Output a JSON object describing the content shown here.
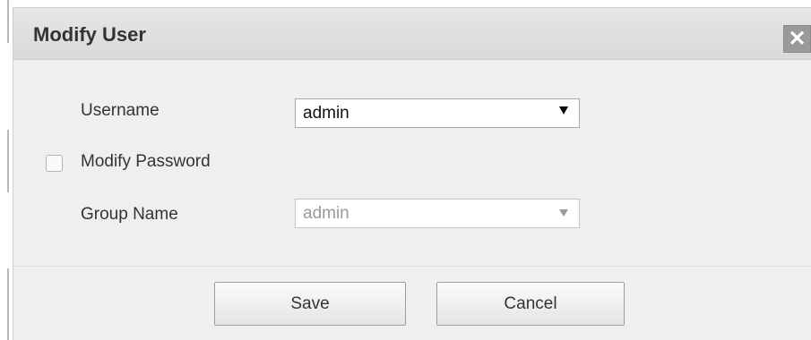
{
  "dialog": {
    "title": "Modify User",
    "close_glyph": "✕"
  },
  "form": {
    "username": {
      "label": "Username",
      "value": "admin"
    },
    "modify_password": {
      "label": "Modify Password",
      "checked": false
    },
    "group_name": {
      "label": "Group Name",
      "value": "admin",
      "disabled": true
    }
  },
  "buttons": {
    "save_label": "Save",
    "cancel_label": "Cancel"
  },
  "icons": {
    "close": "close-icon",
    "dropdown": "chevron-down-icon"
  }
}
